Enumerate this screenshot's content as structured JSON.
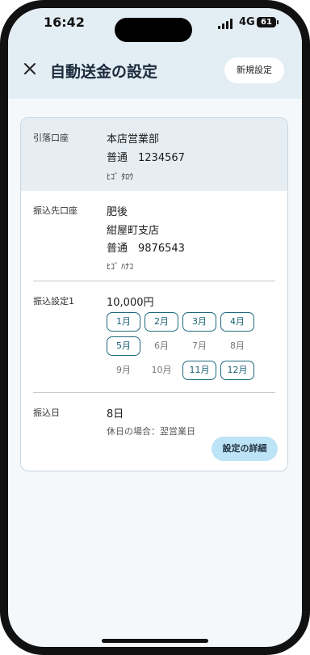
{
  "status_bar": {
    "time": "16:42",
    "network": "4G",
    "battery": "61"
  },
  "header": {
    "title": "自動送金の設定",
    "new_label": "新規設定"
  },
  "debit_account": {
    "label": "引落口座",
    "branch": "本店営業部",
    "account": "普通　1234567",
    "holder": "ﾋｺﾞ ﾀﾛｳ"
  },
  "payee_account": {
    "label": "振込先口座",
    "bank": "肥後",
    "branch": "紺屋町支店",
    "account": "普通　9876543",
    "holder": "ﾋｺﾞ ﾊﾅｺ"
  },
  "transfer_setting": {
    "label": "振込設定1",
    "amount": "10,000円",
    "months": [
      {
        "label": "1月",
        "selected": true
      },
      {
        "label": "2月",
        "selected": true
      },
      {
        "label": "3月",
        "selected": true
      },
      {
        "label": "4月",
        "selected": true
      },
      {
        "label": "5月",
        "selected": true
      },
      {
        "label": "6月",
        "selected": false
      },
      {
        "label": "7月",
        "selected": false
      },
      {
        "label": "8月",
        "selected": false
      },
      {
        "label": "9月",
        "selected": false
      },
      {
        "label": "10月",
        "selected": false
      },
      {
        "label": "11月",
        "selected": true
      },
      {
        "label": "12月",
        "selected": true
      }
    ]
  },
  "transfer_date": {
    "label": "振込日",
    "day": "8日",
    "holiday_note": "休日の場合：翌営業日"
  },
  "detail_button": "設定の詳細"
}
